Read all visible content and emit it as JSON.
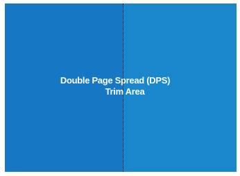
{
  "diagram": {
    "label_line_1": "Double Page Spread (DPS)",
    "label_line_2": "Trim Area",
    "colors": {
      "left_page": "#1677c4",
      "right_page": "#1a86cc",
      "spine_line": "#000000",
      "label_text": "#ffffff",
      "background": "#ffffff"
    }
  }
}
